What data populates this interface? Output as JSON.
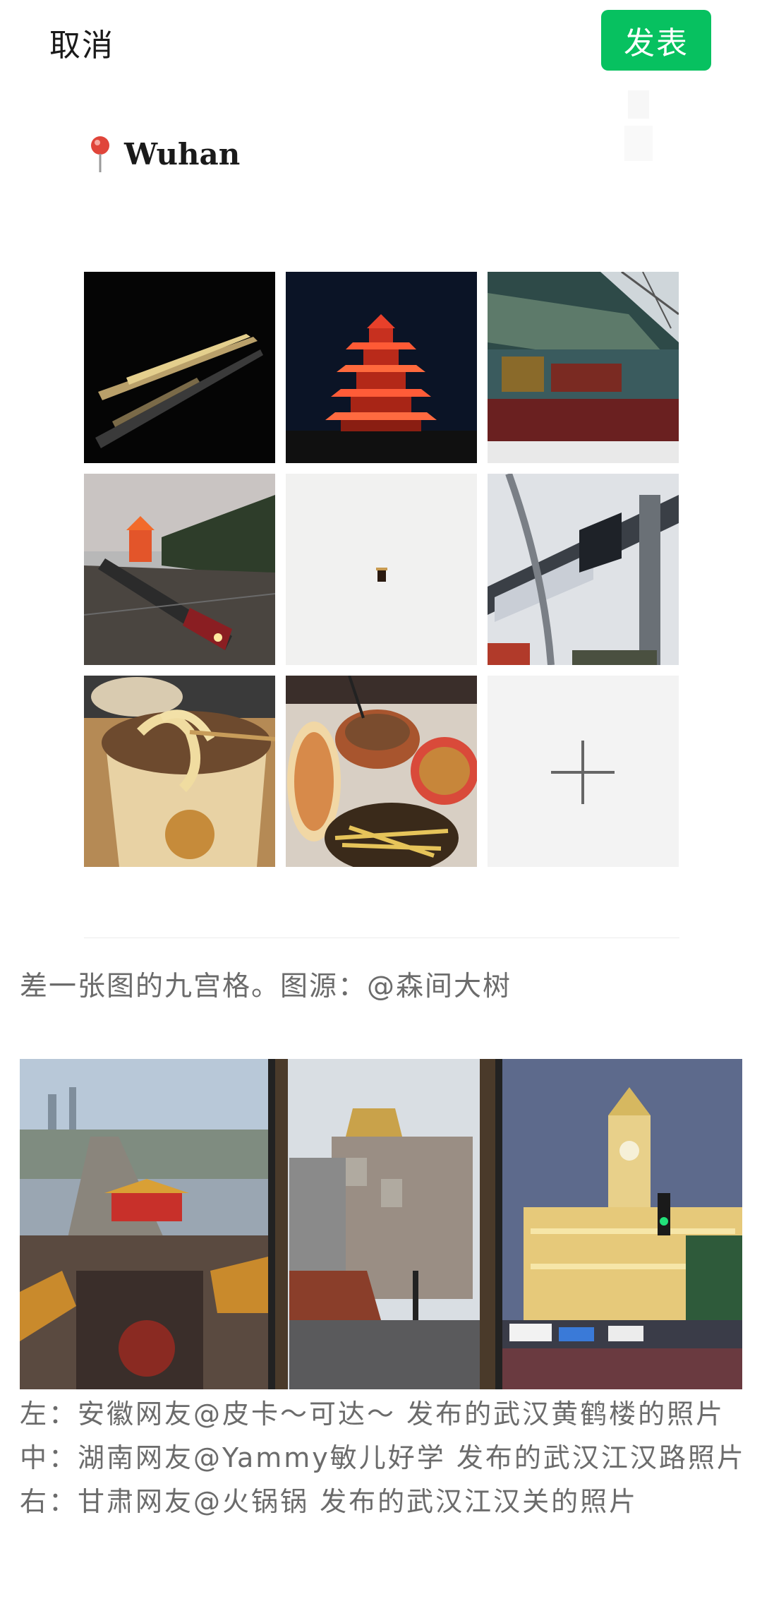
{
  "topbar": {
    "cancel_label": "取消",
    "publish_label": "发表"
  },
  "location": {
    "text": "Wuhan",
    "icon": "pin-icon"
  },
  "grid": {
    "photos": [
      {
        "name": "photo-gold-sword"
      },
      {
        "name": "photo-yellow-crane-tower-night"
      },
      {
        "name": "photo-temple-roof"
      },
      {
        "name": "photo-train-tower"
      },
      {
        "name": "photo-snow-cup"
      },
      {
        "name": "photo-monorail"
      },
      {
        "name": "photo-noodles"
      },
      {
        "name": "photo-food-table"
      }
    ],
    "add_icon": "plus-icon"
  },
  "caption": "差一张图的九宫格。图源：@森间大树",
  "strip": {
    "photos": [
      {
        "name": "photo-aerial-street"
      },
      {
        "name": "photo-jianghan-road"
      },
      {
        "name": "photo-jianghan-customs"
      }
    ]
  },
  "notes": [
    "左：安徽网友@皮卡～可达～ 发布的武汉黄鹤楼的照片",
    "中：湖南网友@Yammy敏儿好学 发布的武汉江汉路照片",
    "右：甘肃网友@火锅锅 发布的武汉江汉关的照片"
  ],
  "colors": {
    "accent": "#07c160",
    "caption": "#6b6b6b",
    "placeholder": "#f3f3f3"
  }
}
